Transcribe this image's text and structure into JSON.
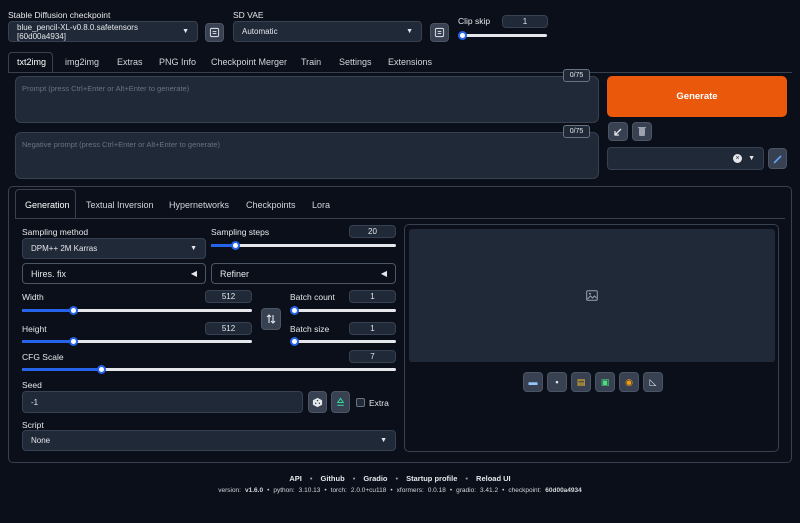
{
  "header": {
    "checkpoint_label": "Stable Diffusion checkpoint",
    "checkpoint_value": "blue_pencil-XL-v0.8.0.safetensors [60d00a4934]",
    "vae_label": "SD VAE",
    "vae_value": "Automatic",
    "clip_skip_label": "Clip skip",
    "clip_skip_value": "1",
    "clip_skip_fraction": 0.0
  },
  "tabs": [
    "txt2img",
    "img2img",
    "Extras",
    "PNG Info",
    "Checkpoint Merger",
    "Train",
    "Settings",
    "Extensions"
  ],
  "active_tab": "txt2img",
  "prompt": {
    "placeholder": "Prompt (press Ctrl+Enter or Alt+Enter to generate)",
    "counter": "0/75",
    "negative_placeholder": "Negative prompt (press Ctrl+Enter or Alt+Enter to generate)",
    "negative_counter": "0/75"
  },
  "generate_label": "Generate",
  "subtabs": [
    "Generation",
    "Textual Inversion",
    "Hypernetworks",
    "Checkpoints",
    "Lora"
  ],
  "generation": {
    "sampling_method_label": "Sampling method",
    "sampling_method_value": "DPM++ 2M Karras",
    "sampling_steps_label": "Sampling steps",
    "sampling_steps_value": "20",
    "sampling_steps_fraction": 0.13,
    "hires_label": "Hires. fix",
    "refiner_label": "Refiner",
    "width_label": "Width",
    "width_value": "512",
    "width_fraction": 0.22,
    "height_label": "Height",
    "height_value": "512",
    "height_fraction": 0.22,
    "batch_count_label": "Batch count",
    "batch_count_value": "1",
    "batch_count_fraction": 0.0,
    "batch_size_label": "Batch size",
    "batch_size_value": "1",
    "batch_size_fraction": 0.0,
    "cfg_label": "CFG Scale",
    "cfg_value": "7",
    "cfg_fraction": 0.21,
    "seed_label": "Seed",
    "seed_value": "-1",
    "extra_label": "Extra",
    "script_label": "Script",
    "script_value": "None"
  },
  "footer": {
    "links": [
      "API",
      "Github",
      "Gradio",
      "Startup profile",
      "Reload UI"
    ],
    "version_prefix": "version:",
    "version": "v1.6.0",
    "python_prefix": "python:",
    "python": "3.10.13",
    "torch_prefix": "torch:",
    "torch": "2.0.0+cu118",
    "xformers_prefix": "xformers:",
    "xformers": "0.0.18",
    "gradio_prefix": "gradio:",
    "gradio": "3.41.2",
    "checkpoint_prefix": "checkpoint:",
    "checkpoint": "60d00a4934",
    "separator": "•"
  },
  "colors": {
    "background": "#0b0f19",
    "panel": "#1f2937",
    "generate": "#ea580c",
    "slider": "#2563eb"
  }
}
